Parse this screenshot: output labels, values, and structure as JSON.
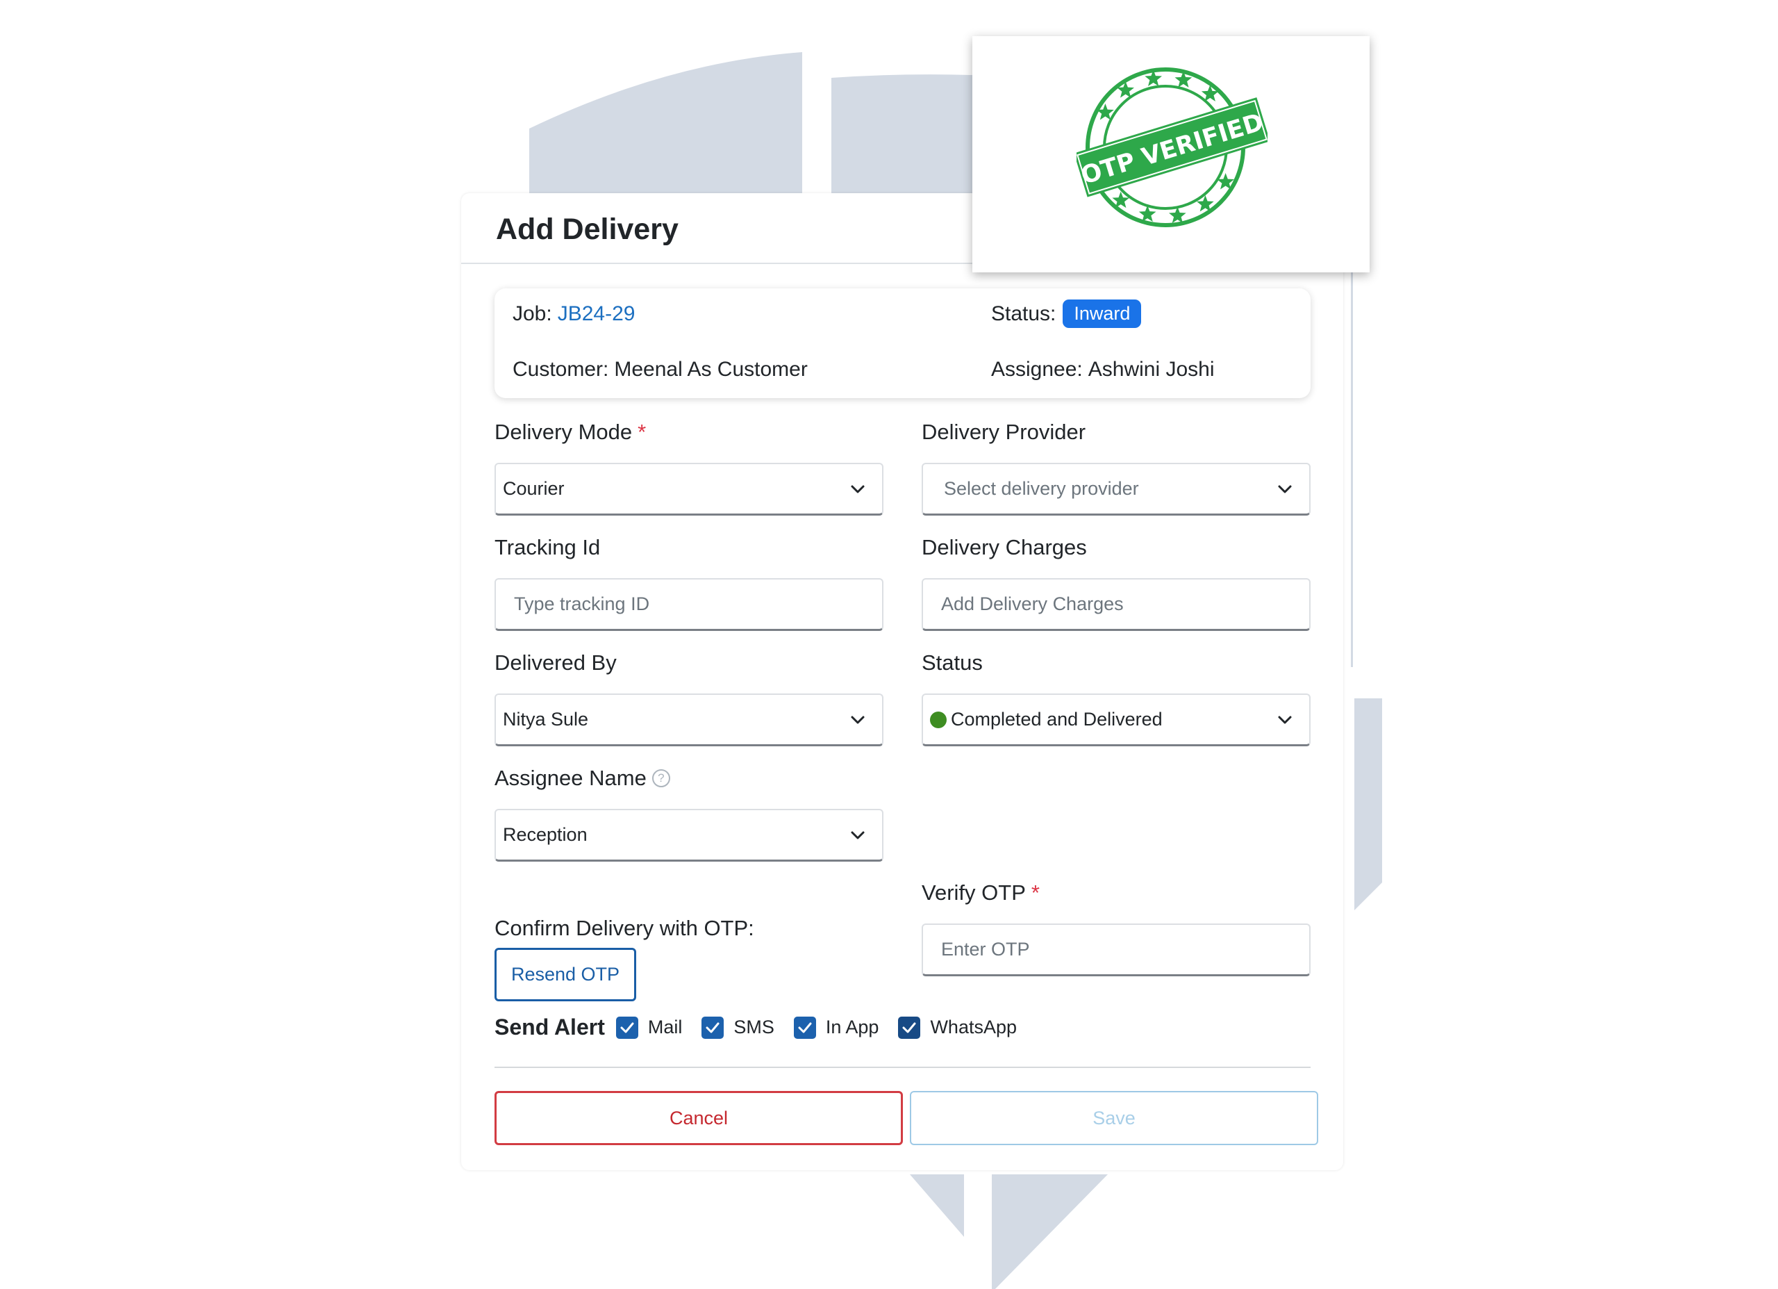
{
  "modal": {
    "title": "Add Delivery"
  },
  "job_info": {
    "job_label": "Job:",
    "job_id": "JB24-29",
    "status_label": "Status:",
    "status_value": "Inward",
    "customer_label": "Customer:",
    "customer_value": "Meenal As Customer",
    "assignee_label": "Assignee:",
    "assignee_value": "Ashwini Joshi"
  },
  "form": {
    "delivery_mode": {
      "label": "Delivery Mode",
      "required_mark": "*",
      "value": "Courier"
    },
    "delivery_provider": {
      "label": "Delivery Provider",
      "placeholder": "Select delivery provider"
    },
    "tracking_id": {
      "label": "Tracking Id",
      "placeholder": "Type tracking ID"
    },
    "delivery_charges": {
      "label": "Delivery Charges",
      "placeholder": "Add Delivery Charges"
    },
    "delivered_by": {
      "label": "Delivered By",
      "value": "Nitya Sule"
    },
    "status": {
      "label": "Status",
      "value": "Completed and Delivered",
      "dot_color": "#3e8d22"
    },
    "assignee_name": {
      "label": "Assignee Name",
      "help_glyph": "?",
      "value": "Reception"
    },
    "verify_otp": {
      "label": "Verify OTP",
      "required_mark": "*",
      "placeholder": "Enter OTP"
    },
    "confirm_otp": {
      "label": "Confirm Delivery with OTP:",
      "resend_label": "Resend OTP"
    }
  },
  "send_alert": {
    "title": "Send Alert",
    "options": [
      {
        "label": "Mail",
        "checked": true
      },
      {
        "label": "SMS",
        "checked": true
      },
      {
        "label": "In App",
        "checked": true
      },
      {
        "label": "WhatsApp",
        "checked": true
      }
    ]
  },
  "actions": {
    "cancel_label": "Cancel",
    "save_label": "Save"
  },
  "stamp": {
    "text": "OTP VERIFIED",
    "color": "#2ea84a"
  },
  "colors": {
    "primary": "#1a73e8",
    "link": "#1c6fc0",
    "danger": "#d23c43",
    "save_disabled": "#a9cfe8",
    "background_shapes": "#d3dae4"
  }
}
